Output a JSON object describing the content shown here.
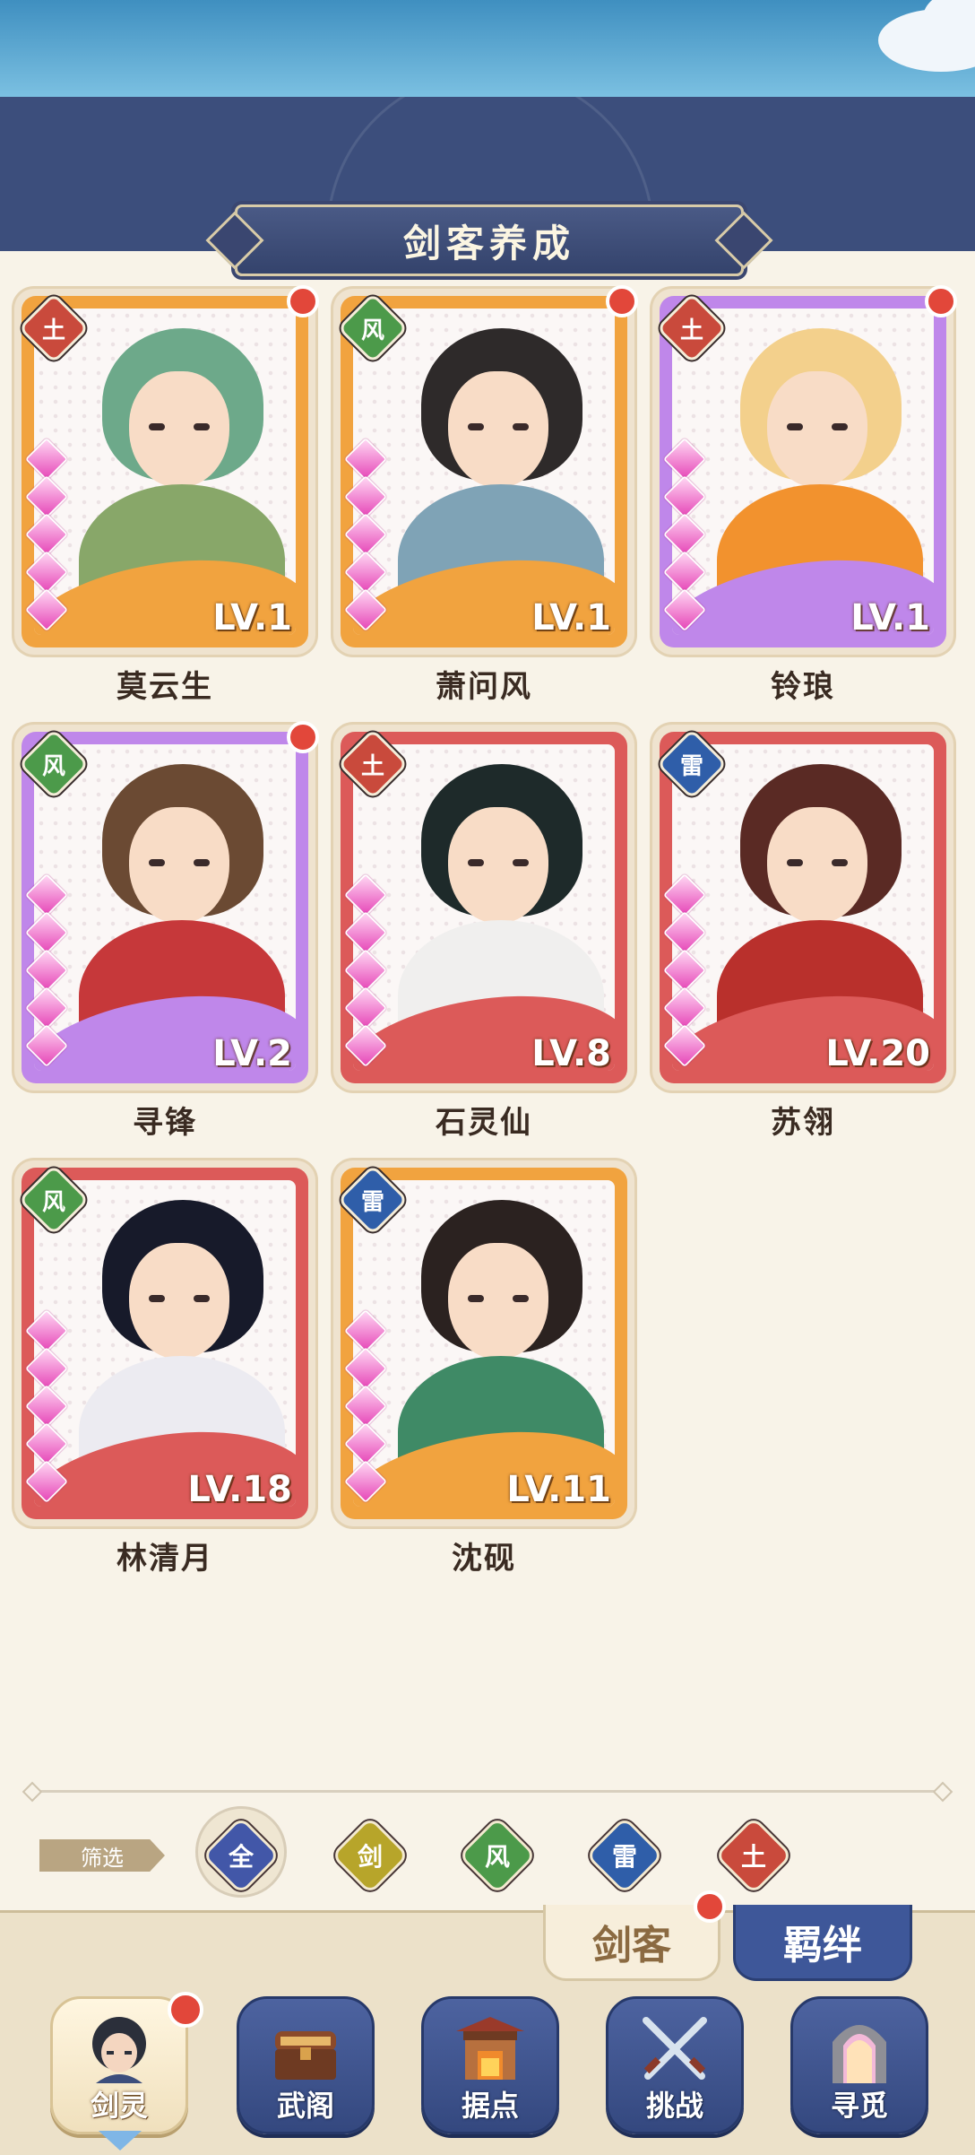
{
  "header": {
    "title": "剑客养成"
  },
  "characters": [
    {
      "name": "莫云生",
      "level": "LV.1",
      "element": "土",
      "stars": 5,
      "notify": true
    },
    {
      "name": "萧问风",
      "level": "LV.1",
      "element": "风",
      "stars": 5,
      "notify": true
    },
    {
      "name": "铃琅",
      "level": "LV.1",
      "element": "土",
      "stars": 5,
      "notify": true
    },
    {
      "name": "寻锋",
      "level": "LV.2",
      "element": "风",
      "stars": 5,
      "notify": true
    },
    {
      "name": "石灵仙",
      "level": "LV.8",
      "element": "土",
      "stars": 5,
      "notify": false
    },
    {
      "name": "苏翎",
      "level": "LV.20",
      "element": "雷",
      "stars": 5,
      "notify": false
    },
    {
      "name": "林清月",
      "level": "LV.18",
      "element": "风",
      "stars": 5,
      "notify": false
    },
    {
      "name": "沈砚",
      "level": "LV.11",
      "element": "雷",
      "stars": 5,
      "notify": false
    }
  ],
  "filter": {
    "label": "筛选",
    "options": [
      {
        "id": "all",
        "label": "全",
        "selected": true
      },
      {
        "id": "sword",
        "label": "剑",
        "selected": false
      },
      {
        "id": "wind",
        "label": "风",
        "selected": false
      },
      {
        "id": "thunder",
        "label": "雷",
        "selected": false
      },
      {
        "id": "earth",
        "label": "土",
        "selected": false
      }
    ]
  },
  "tabs": {
    "jianke": "剑客",
    "jiban": "羁绊"
  },
  "nav": {
    "jianling": "剑灵",
    "wuge": "武阁",
    "judian": "据点",
    "tiaozhan": "挑战",
    "xunmi": "寻觅"
  },
  "colors": {
    "banner": "#3c4e7c",
    "card_orange": "#f1a33f",
    "card_purple": "#bf87ea",
    "card_red": "#dc5a59",
    "gem_pink": "#e648b8",
    "notify_red": "#e2473a",
    "element_earth": "#c94a3c",
    "element_wind": "#4c9a4a",
    "element_thunder": "#2f5ea9",
    "element_sword": "#b7a52a",
    "element_all": "#4257a8"
  }
}
